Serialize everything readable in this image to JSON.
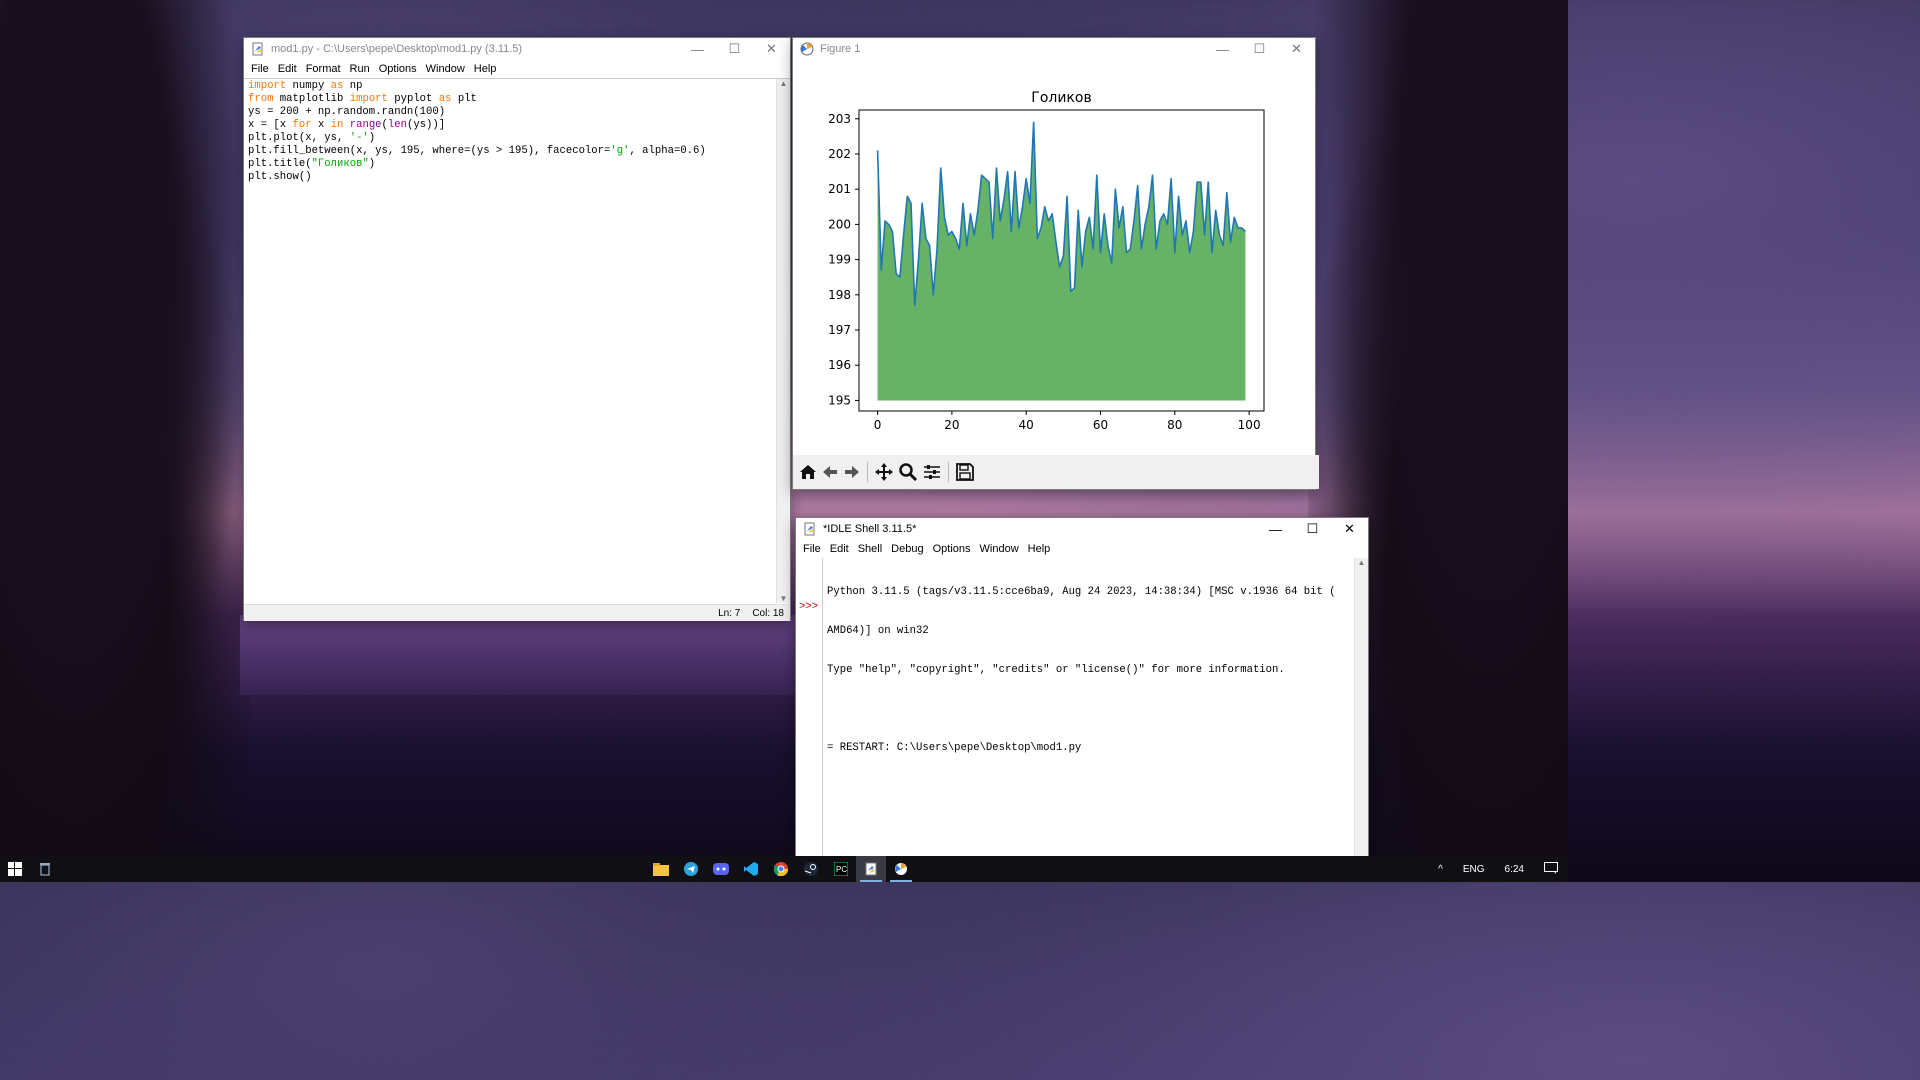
{
  "editor": {
    "title": "mod1.py - C:\\Users\\pepe\\Desktop\\mod1.py (3.11.5)",
    "menu": [
      "File",
      "Edit",
      "Format",
      "Run",
      "Options",
      "Window",
      "Help"
    ],
    "status": {
      "ln": "Ln: 7",
      "col": "Col: 18"
    }
  },
  "figure": {
    "title": "Figure 1",
    "toolbar": [
      "home-icon",
      "back-icon",
      "forward-icon",
      "pan-icon",
      "zoom-icon",
      "configure-icon",
      "save-icon"
    ]
  },
  "shell": {
    "title": "*IDLE Shell 3.11.5*",
    "menu": [
      "File",
      "Edit",
      "Shell",
      "Debug",
      "Options",
      "Window",
      "Help"
    ],
    "prompt": ">>>",
    "lines": [
      "Python 3.11.5 (tags/v3.11.5:cce6ba9, Aug 24 2023, 14:38:34) [MSC v.1936 64 bit (",
      "AMD64)] on win32",
      "Type \"help\", \"copyright\", \"credits\" or \"license()\" for more information.",
      "",
      "= RESTART: C:\\Users\\pepe\\Desktop\\mod1.py"
    ]
  },
  "taskbar": {
    "apps": [
      "start-icon",
      "recycle-bin-icon",
      "file-explorer-icon",
      "telegram-icon",
      "discord-icon",
      "vscode-icon",
      "chrome-icon",
      "steam-icon",
      "pycharm-icon",
      "idle-icon",
      "python-figure-icon"
    ],
    "lang": "ENG",
    "time": "6:24"
  },
  "chart_data": {
    "type": "line",
    "title": "Голиков",
    "xlim": [
      -5,
      104
    ],
    "ylim": [
      194.7,
      203.25
    ],
    "xticks": [
      0,
      20,
      40,
      60,
      80,
      100
    ],
    "yticks": [
      195,
      196,
      197,
      198,
      199,
      200,
      201,
      202,
      203
    ],
    "fill_baseline": 195,
    "line_color": "#1f77b4",
    "fill_color": "#66b266",
    "grid": false,
    "series": [
      {
        "x": [
          0,
          1,
          2,
          3,
          4,
          5,
          6,
          7,
          8,
          9,
          10,
          11,
          12,
          13,
          14,
          15,
          16,
          17,
          18,
          19,
          20,
          21,
          22,
          23,
          24,
          25,
          26,
          27,
          28,
          29,
          30,
          31,
          32,
          33,
          34,
          35,
          36,
          37,
          38,
          39,
          40,
          41,
          42,
          43,
          44,
          45,
          46,
          47,
          48,
          49,
          50,
          51,
          52,
          53,
          54,
          55,
          56,
          57,
          58,
          59,
          60,
          61,
          62,
          63,
          64,
          65,
          66,
          67,
          68,
          69,
          70,
          71,
          72,
          73,
          74,
          75,
          76,
          77,
          78,
          79,
          80,
          81,
          82,
          83,
          84,
          85,
          86,
          87,
          88,
          89,
          90,
          91,
          92,
          93,
          94,
          95,
          96,
          97,
          98,
          99
        ],
        "values": [
          202.1,
          198.7,
          200.1,
          200.0,
          199.8,
          198.6,
          198.5,
          199.7,
          200.8,
          200.6,
          197.7,
          199.0,
          200.6,
          199.6,
          199.4,
          198.0,
          199.3,
          201.6,
          200.2,
          199.7,
          199.8,
          199.6,
          199.3,
          200.6,
          199.4,
          200.3,
          199.7,
          200.4,
          201.4,
          201.3,
          201.2,
          199.6,
          201.6,
          200.1,
          200.7,
          201.5,
          199.8,
          201.5,
          199.9,
          200.5,
          201.3,
          200.6,
          202.9,
          199.6,
          199.9,
          200.5,
          200.1,
          200.3,
          199.5,
          198.8,
          199.1,
          200.8,
          198.1,
          198.2,
          200.4,
          198.8,
          199.8,
          200.2,
          199.3,
          201.4,
          199.2,
          200.3,
          199.4,
          198.9,
          201.0,
          199.9,
          200.5,
          199.2,
          199.3,
          200.1,
          201.1,
          199.3,
          200.0,
          200.5,
          201.4,
          199.3,
          200.1,
          200.3,
          200.0,
          201.3,
          199.2,
          200.8,
          199.7,
          200.1,
          199.2,
          199.8,
          201.2,
          201.2,
          199.7,
          201.2,
          199.2,
          200.4,
          199.7,
          199.4,
          200.9,
          199.5,
          200.2,
          199.9,
          199.9,
          199.8
        ]
      }
    ]
  }
}
